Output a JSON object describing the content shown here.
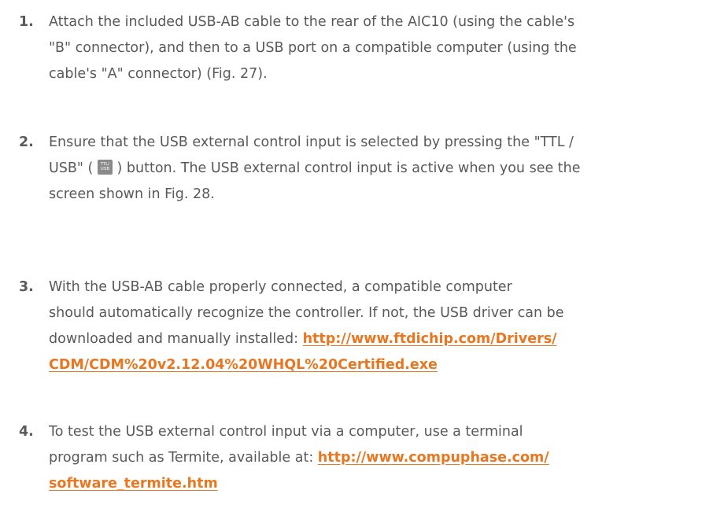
{
  "steps": [
    {
      "number": "1.",
      "lines": [
        "Attach the included USB-AB cable to the rear of the AIC10 (using the cable's",
        "\"B\" connector), and then to a USB port on a compatible computer (using the",
        "cable's \"A\" connector) (Fig. 27)."
      ]
    },
    {
      "number": "2.",
      "line1": "Ensure that the USB external control input is selected by pressing the \"TTL /",
      "line2_before": "USB\" (",
      "icon_top": "TTL/",
      "icon_bottom": "USB",
      "line2_after": ") button. The USB external control input is active when you see the",
      "line3": "screen shown in Fig. 28."
    },
    {
      "number": "3.",
      "line1": "With the USB-AB cable properly connected, a compatible computer",
      "line2": "should automatically recognize the controller. If not, the USB driver can be",
      "line3": "downloaded and manually installed: ",
      "link_line1": "http://www.ftdichip.com/Drivers/",
      "link_line2": "CDM/CDM%20v2.12.04%20WHQL%20Certified.exe"
    },
    {
      "number": "4.",
      "line1": "To test the USB external control input via a computer, use a terminal",
      "line2": "program such as Termite, available at: ",
      "link_line1": "http://www.compuphase.com/",
      "link_line2": "software_termite.htm"
    }
  ],
  "colors": {
    "text": "#595959",
    "link": "#e87722",
    "icon_bg": "#8a8a8a"
  }
}
